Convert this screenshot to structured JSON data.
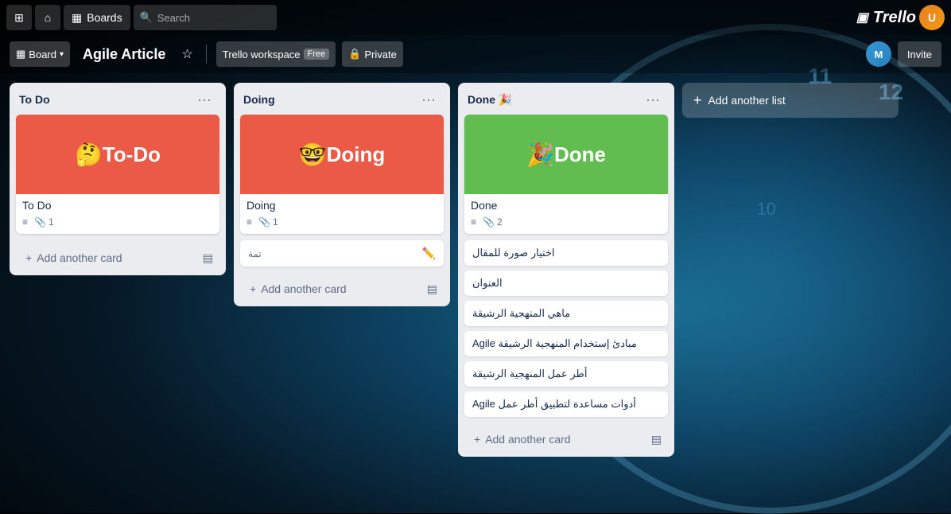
{
  "topnav": {
    "apps_icon": "⊞",
    "home_icon": "⌂",
    "board_icon": "▦",
    "boards_label": "Boards",
    "search_placeholder": "Search",
    "trello_label": "Trello"
  },
  "boardnav": {
    "board_prefix": "Board",
    "board_title": "Agile Article",
    "workspace_label": "Trello workspace",
    "workspace_badge": "Free",
    "private_label": "Private",
    "invite_label": "Invite"
  },
  "lists": [
    {
      "id": "todo",
      "title": "To Do",
      "cards": [
        {
          "id": "todo-card-1",
          "cover_color": "red",
          "cover_emoji": "🤔",
          "cover_text": "To-Do",
          "title": "To Do",
          "has_description": true,
          "attachment_count": "1"
        }
      ],
      "add_card_label": "Add another card"
    },
    {
      "id": "doing",
      "title": "Doing",
      "cards": [
        {
          "id": "doing-card-1",
          "cover_color": "red",
          "cover_emoji": "🤓",
          "cover_text": "Doing",
          "title": "Doing",
          "has_description": true,
          "attachment_count": "1"
        },
        {
          "id": "doing-card-editing",
          "is_editing": true,
          "edit_label": "تمة",
          "has_edit_icon": true
        }
      ],
      "add_card_label": "Add another card"
    },
    {
      "id": "done",
      "title": "Done 🎉",
      "cards": [
        {
          "id": "done-card-1",
          "cover_color": "green",
          "cover_emoji": "🎉",
          "cover_text": "Done",
          "title": "Done",
          "has_description": true,
          "attachment_count": "2"
        },
        {
          "id": "done-simple-1",
          "simple": true,
          "title": "اختيار صورة للمقال"
        },
        {
          "id": "done-simple-2",
          "simple": true,
          "title": "العنوان"
        },
        {
          "id": "done-simple-3",
          "simple": true,
          "title": "ماهي المنهجية الرشيقة"
        },
        {
          "id": "done-simple-4",
          "simple": true,
          "title": "مبادئ إستخدام المنهجية الرشيقة Agile"
        },
        {
          "id": "done-simple-5",
          "simple": true,
          "title": "أطر عمل المنهجية الرشيقة"
        },
        {
          "id": "done-simple-6",
          "simple": true,
          "title": "أدوات مساعدة لتطبيق أطر عمل Agile"
        }
      ],
      "add_card_label": "Add another card"
    }
  ],
  "add_list_label": "Add another list"
}
